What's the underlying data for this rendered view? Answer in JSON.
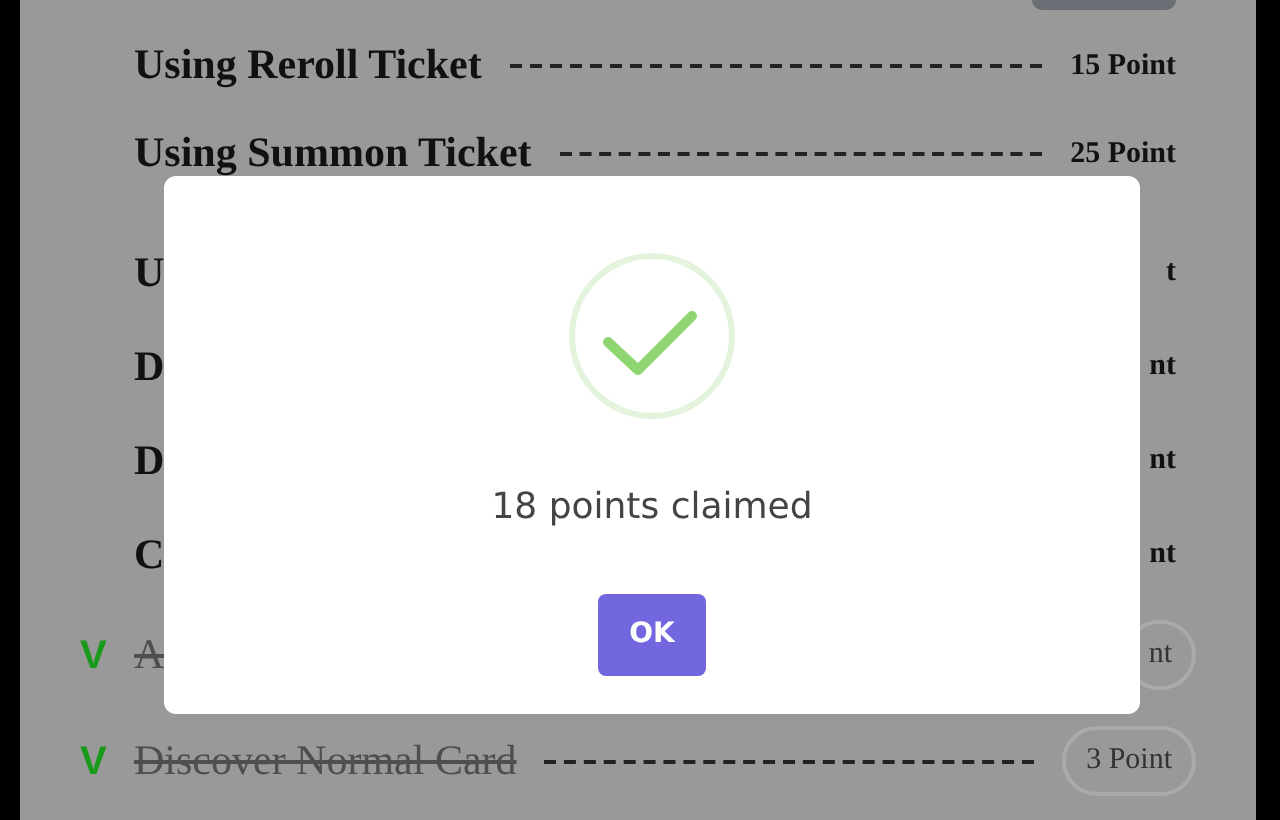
{
  "tasks": [
    {
      "title": "Using Reroll Ticket",
      "points": "15 Point",
      "done": false
    },
    {
      "title": "Using Summon Ticket",
      "points": "25 Point",
      "done": false
    },
    {
      "title": "U",
      "points": "t",
      "done": false
    },
    {
      "title": "D",
      "points": "nt",
      "done": false
    },
    {
      "title": "D",
      "points": "nt",
      "done": false
    },
    {
      "title": "C",
      "points": "nt",
      "done": false
    },
    {
      "title": "A",
      "points": "nt",
      "done": true,
      "mark": "V"
    },
    {
      "title": "Discover Normal Card",
      "points": "3 Point",
      "done": true,
      "mark": "V"
    }
  ],
  "dialog": {
    "message": "18 points claimed",
    "button": "OK"
  }
}
